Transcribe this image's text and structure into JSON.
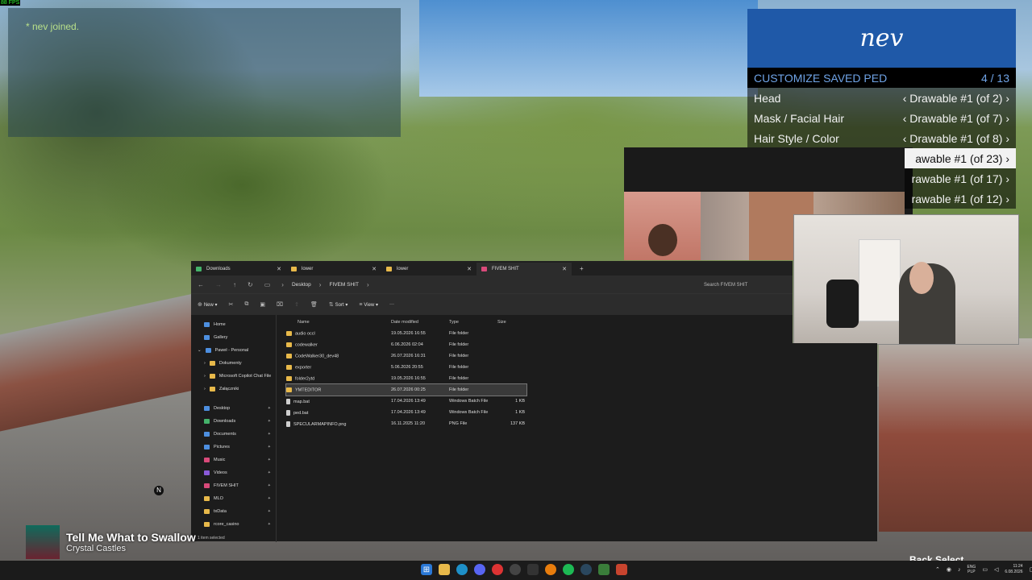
{
  "overlay": {
    "fps": "88 FPS"
  },
  "chat": {
    "line": "* nev joined."
  },
  "menu": {
    "banner": "nev",
    "subtitle": "CUSTOMIZE SAVED PED",
    "counter": "4 / 13",
    "rows": [
      {
        "label": "Head",
        "value": "‹ Drawable #1 (of 2) ›"
      },
      {
        "label": "Mask / Facial Hair",
        "value": "‹ Drawable #1 (of 7) ›"
      },
      {
        "label": "Hair Style / Color",
        "value": "‹ Drawable #1 (of 8) ›"
      }
    ],
    "partial_rows": [
      {
        "value": "awable #1 (of 23) ›"
      },
      {
        "value": "rawable #1 (of 17) ›"
      },
      {
        "value": "rawable #1 (of 12) ›"
      }
    ]
  },
  "explorer": {
    "tabs": [
      {
        "label": "Downloads",
        "color": "#45b36b"
      },
      {
        "label": "lower",
        "color": "#e8b94a"
      },
      {
        "label": "lower",
        "color": "#e8b94a"
      },
      {
        "label": "FIVEM SHIT",
        "color": "#d94a7a"
      }
    ],
    "new_tab": "+",
    "breadcrumb": [
      "Desktop",
      "FIVEM SHIT"
    ],
    "search_placeholder": "Search FIVEM SHIT",
    "toolbar": {
      "new": "New",
      "sort": "Sort",
      "view": "View",
      "more": "···"
    },
    "nav": [
      {
        "label": "Home",
        "icon": "home-icon"
      },
      {
        "label": "Gallery",
        "icon": "gallery-icon"
      },
      {
        "label": "Paweł - Personal",
        "icon": "cloud-icon"
      },
      {
        "label": "Dokumenty",
        "icon": "folder-icon"
      },
      {
        "label": "Microsoft Copilot Chat File",
        "icon": "folder-icon"
      },
      {
        "label": "Załączniki",
        "icon": "folder-icon"
      },
      {
        "label": "Desktop",
        "icon": "desktop-icon"
      },
      {
        "label": "Downloads",
        "icon": "download-icon"
      },
      {
        "label": "Documents",
        "icon": "documents-icon"
      },
      {
        "label": "Pictures",
        "icon": "pictures-icon"
      },
      {
        "label": "Music",
        "icon": "music-icon"
      },
      {
        "label": "Videos",
        "icon": "videos-icon"
      },
      {
        "label": "FIVEM SHIT",
        "icon": "folder-pink-icon"
      },
      {
        "label": "MLO",
        "icon": "folder-icon"
      },
      {
        "label": "txData",
        "icon": "folder-icon"
      },
      {
        "label": "rcore_casino",
        "icon": "folder-icon"
      }
    ],
    "columns": [
      "Name",
      "Date modified",
      "Type",
      "Size"
    ],
    "files": [
      {
        "name": "audio occl",
        "date": "19.05.2026 16:55",
        "type": "File folder",
        "size": ""
      },
      {
        "name": "codewalker",
        "date": "6.06.2026 02:04",
        "type": "File folder",
        "size": ""
      },
      {
        "name": "CodeWalker30_dev48",
        "date": "26.07.2026 16:31",
        "type": "File folder",
        "size": ""
      },
      {
        "name": "exporter",
        "date": "5.06.2026 20:55",
        "type": "File folder",
        "size": ""
      },
      {
        "name": "folder2ytd",
        "date": "19.05.2026 16:55",
        "type": "File folder",
        "size": ""
      },
      {
        "name": "YMTEDITOR",
        "date": "26.07.2026 00:25",
        "type": "File folder",
        "size": ""
      },
      {
        "name": "map.bat",
        "date": "17.04.2026 13:49",
        "type": "Windows Batch File",
        "size": "1 KB"
      },
      {
        "name": "ped.bat",
        "date": "17.04.2026 13:49",
        "type": "Windows Batch File",
        "size": "1 KB"
      },
      {
        "name": "SPECULARMAPINFO.png",
        "date": "16.11.2025 11:20",
        "type": "PNG File",
        "size": "137 KB"
      }
    ],
    "status": "1 item selected"
  },
  "now_playing": {
    "title": "Tell Me What to Swallow",
    "artist": "Crystal Castles"
  },
  "badge": "N",
  "hint": "Back  Select",
  "taskbar": {
    "lang_top": "ENG",
    "lang_bottom": "PLP",
    "time": "11:24",
    "date": "6.08.2026"
  }
}
